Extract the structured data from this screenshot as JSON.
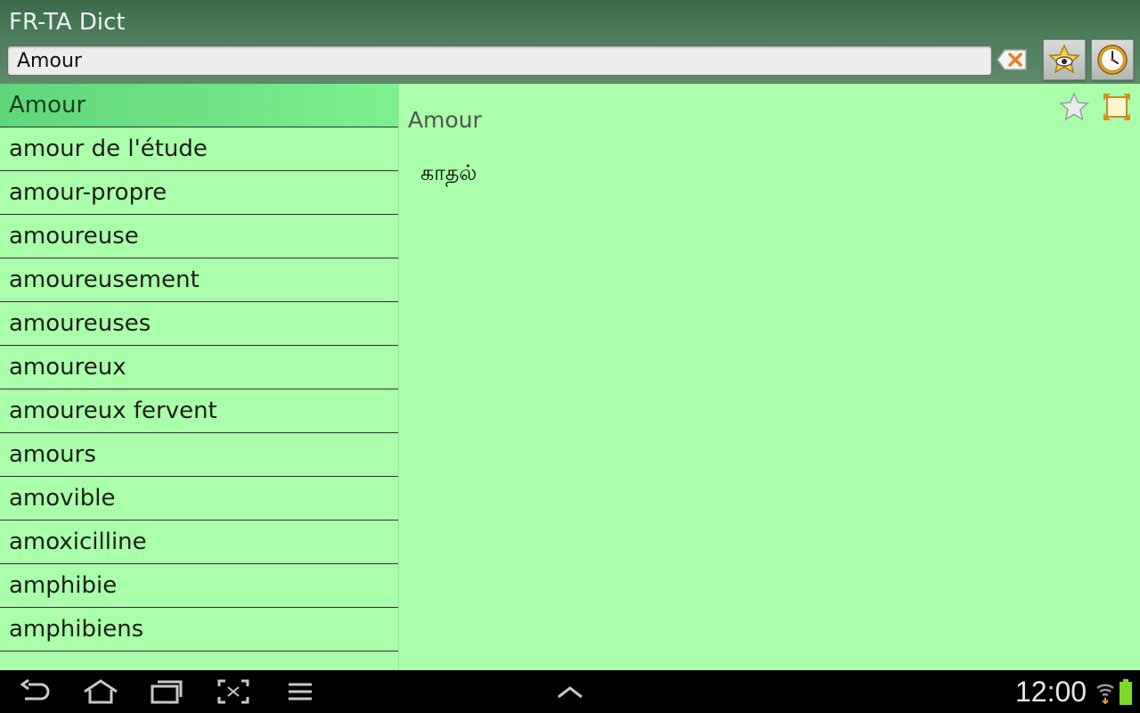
{
  "app": {
    "title": "FR-TA Dict"
  },
  "search": {
    "value": "Amour"
  },
  "toolbar": {
    "clear_icon": "backspace-clear-icon",
    "favorites_icon": "star-eye-icon",
    "history_icon": "clock-icon"
  },
  "word_list": {
    "items": [
      "Amour",
      "amour de l'étude",
      "amour-propre",
      "amoureuse",
      "amoureusement",
      "amoureuses",
      "amoureux",
      "amoureux fervent",
      "amours",
      "amovible",
      "amoxicilline",
      "amphibie",
      "amphibiens"
    ],
    "selected_index": 0
  },
  "detail": {
    "word": "Amour",
    "translation": "காதல்",
    "star_icon": "star-outline-icon",
    "expand_icon": "fullscreen-icon"
  },
  "status_bar": {
    "time": "12:00"
  },
  "colors": {
    "header": "#4f7f5d",
    "background": "#aaffaa",
    "selected": "#6fe586",
    "navbar": "#000000"
  }
}
